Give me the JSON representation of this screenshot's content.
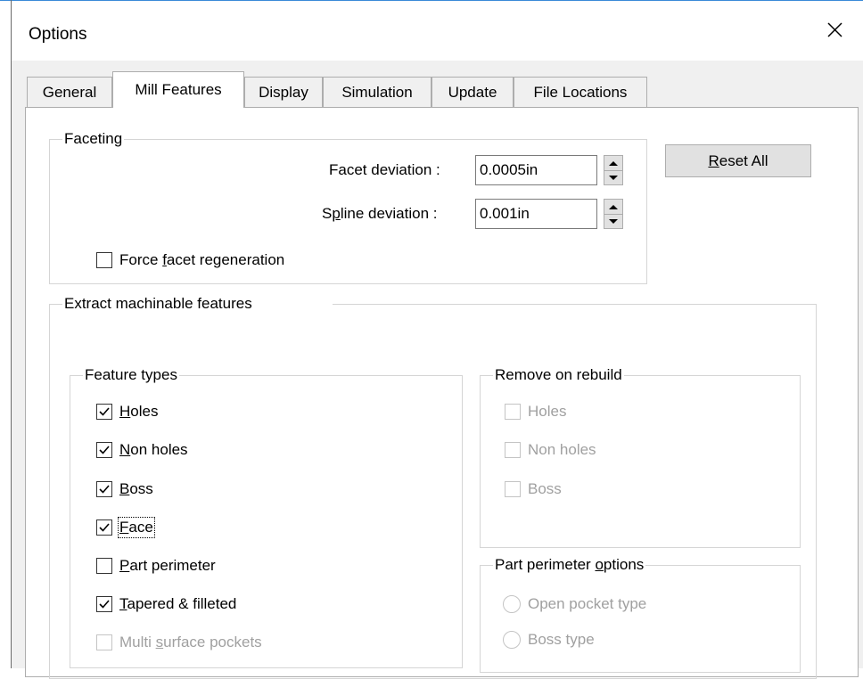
{
  "window": {
    "title": "Options",
    "close_glyph": "close-icon"
  },
  "tabs": [
    {
      "label": "General",
      "active": false
    },
    {
      "label": "Mill Features",
      "active": true
    },
    {
      "label": "Display",
      "active": false
    },
    {
      "label": "Simulation",
      "active": false
    },
    {
      "label": "Update",
      "active": false
    },
    {
      "label": "File Locations",
      "active": false
    }
  ],
  "faceting": {
    "legend": "Faceting",
    "facet_deviation": {
      "label_pre": "Facet deviation :",
      "value": "0.0005in"
    },
    "spline_deviation": {
      "label_a": "S",
      "label_u": "p",
      "label_b": "line deviation :",
      "value": "0.001in"
    },
    "force_regen": {
      "label_a": "Force ",
      "label_u": "f",
      "label_b": "acet regeneration",
      "checked": false
    }
  },
  "reset_button": {
    "label_u": "R",
    "label_b": "eset All"
  },
  "extract": {
    "legend": "Extract machinable features",
    "feature_types": {
      "legend": "Feature types",
      "items": [
        {
          "u": "H",
          "rest": "oles",
          "checked": true,
          "enabled": true
        },
        {
          "u": "N",
          "rest": "on holes",
          "checked": true,
          "enabled": true
        },
        {
          "u": "B",
          "rest": "oss",
          "checked": true,
          "enabled": true
        },
        {
          "u": "F",
          "rest": "ace",
          "checked": true,
          "enabled": true
        },
        {
          "u": "P",
          "rest": "art perimeter",
          "checked": false,
          "enabled": true
        },
        {
          "u": "T",
          "rest": "apered & filleted",
          "checked": true,
          "enabled": true
        },
        {
          "pre": "Multi ",
          "u": "s",
          "rest": "urface pockets",
          "checked": false,
          "enabled": false
        }
      ]
    },
    "remove_on_rebuild": {
      "legend": "Remove on rebuild",
      "items": [
        {
          "label": "Holes",
          "checked": false
        },
        {
          "label": "Non holes",
          "checked": false
        },
        {
          "label": "Boss",
          "checked": false
        }
      ]
    },
    "part_perimeter_options": {
      "legend_a": "Part perimeter ",
      "legend_u": "o",
      "legend_b": "ptions",
      "items": [
        {
          "label": "Open pocket type"
        },
        {
          "label": "Boss type"
        }
      ]
    }
  }
}
